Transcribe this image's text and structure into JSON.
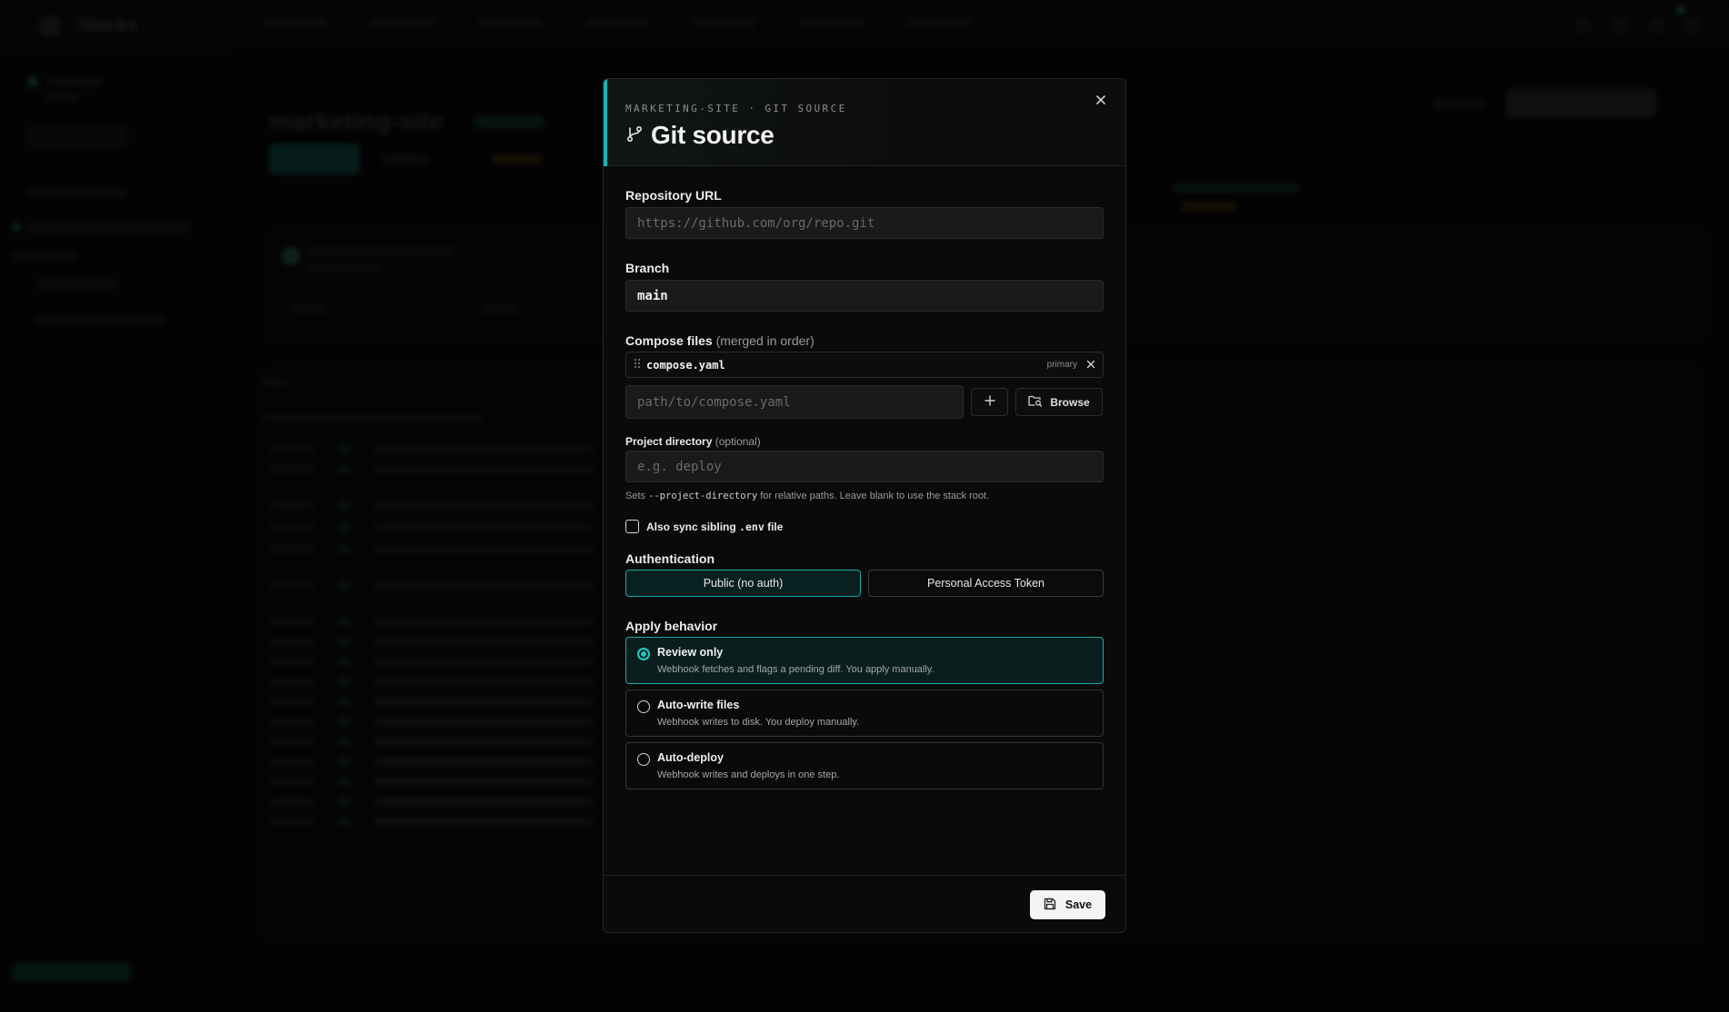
{
  "background_app": {
    "brand": "Stacks",
    "page_title": "marketing-site"
  },
  "modal": {
    "eyebrow": "MARKETING-SITE · GIT SOURCE",
    "title": "Git source",
    "title_icon": "git-branch-icon",
    "close_icon": "close-icon",
    "accent_color": "#19b4b4",
    "repository": {
      "label": "Repository URL",
      "placeholder": "https://github.com/org/repo.git",
      "value": ""
    },
    "branch": {
      "label": "Branch",
      "value": "main"
    },
    "compose": {
      "label": "Compose files",
      "label_suffix": "(merged in order)",
      "files": [
        {
          "name": "compose.yaml",
          "tag": "primary"
        }
      ],
      "add_placeholder": "path/to/compose.yaml",
      "add_icon": "plus-icon",
      "browse_label": "Browse",
      "browse_icon": "folder-search-icon"
    },
    "project_dir": {
      "label": "Project directory",
      "label_suffix": "(optional)",
      "placeholder": "e.g. deploy",
      "hint_prefix": "Sets",
      "hint_code": "--project-directory",
      "hint_suffix": "for relative paths. Leave blank to use the stack root."
    },
    "sync_env": {
      "label_prefix": "Also sync sibling",
      "label_code": ".env",
      "label_suffix": "file",
      "checked": false
    },
    "authentication": {
      "label": "Authentication",
      "options": [
        "Public (no auth)",
        "Personal Access Token"
      ],
      "selected": "Public (no auth)"
    },
    "apply_behavior": {
      "label": "Apply behavior",
      "options": [
        {
          "title": "Review only",
          "desc": "Webhook fetches and flags a pending diff. You apply manually.",
          "selected": true
        },
        {
          "title": "Auto-write files",
          "desc": "Webhook writes to disk. You deploy manually.",
          "selected": false
        },
        {
          "title": "Auto-deploy",
          "desc": "Webhook writes and deploys in one step.",
          "selected": false
        }
      ]
    },
    "footer": {
      "save_label": "Save",
      "save_icon": "save-icon"
    }
  }
}
